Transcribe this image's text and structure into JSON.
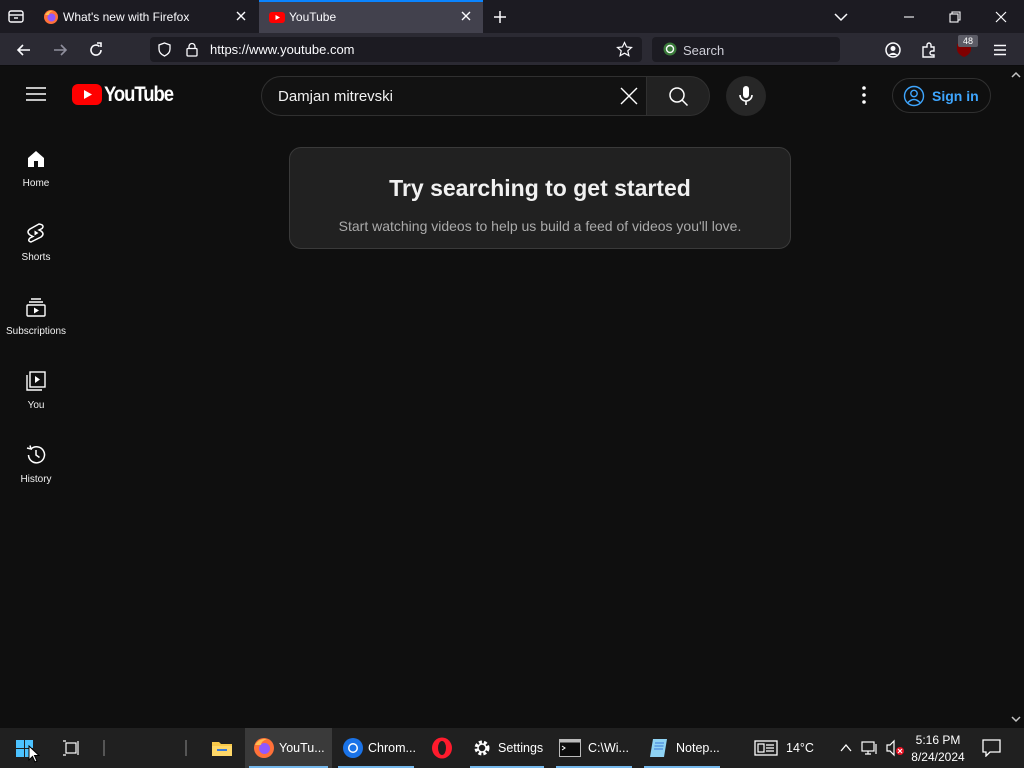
{
  "browser": {
    "tabs": [
      {
        "title": "What's new with Firefox",
        "active": false
      },
      {
        "title": "YouTube",
        "active": true
      }
    ],
    "url": "https://www.youtube.com",
    "search_placeholder": "Search",
    "extension_badge": "48",
    "accent": "#0a84ff"
  },
  "youtube": {
    "logo_text": "YouTube",
    "search_value": "Damjan mitrevski",
    "signin_label": "Sign in",
    "sidebar": [
      {
        "label": "Home",
        "icon": "home-icon"
      },
      {
        "label": "Shorts",
        "icon": "shorts-icon"
      },
      {
        "label": "Subscriptions",
        "icon": "subscriptions-icon"
      },
      {
        "label": "You",
        "icon": "you-icon"
      },
      {
        "label": "History",
        "icon": "history-icon"
      }
    ],
    "empty_title": "Try searching to get started",
    "empty_subtitle": "Start watching videos to help us build a feed of videos you'll love.",
    "brand_red": "#ff0000",
    "link_blue": "#3ea6ff"
  },
  "taskbar": {
    "items": [
      {
        "label": "",
        "icon": "file-explorer-icon"
      },
      {
        "label": "YouTu...",
        "icon": "firefox-icon"
      },
      {
        "label": "Chrom...",
        "icon": "chrome-icon"
      },
      {
        "label": "",
        "icon": "opera-icon"
      },
      {
        "label": "Settings",
        "icon": "settings-gear-icon"
      },
      {
        "label": "C:\\Wi...",
        "icon": "terminal-icon"
      },
      {
        "label": "Notep...",
        "icon": "notepad-icon"
      }
    ],
    "weather": "14°C",
    "time": "5:16 PM",
    "date": "8/24/2024"
  }
}
